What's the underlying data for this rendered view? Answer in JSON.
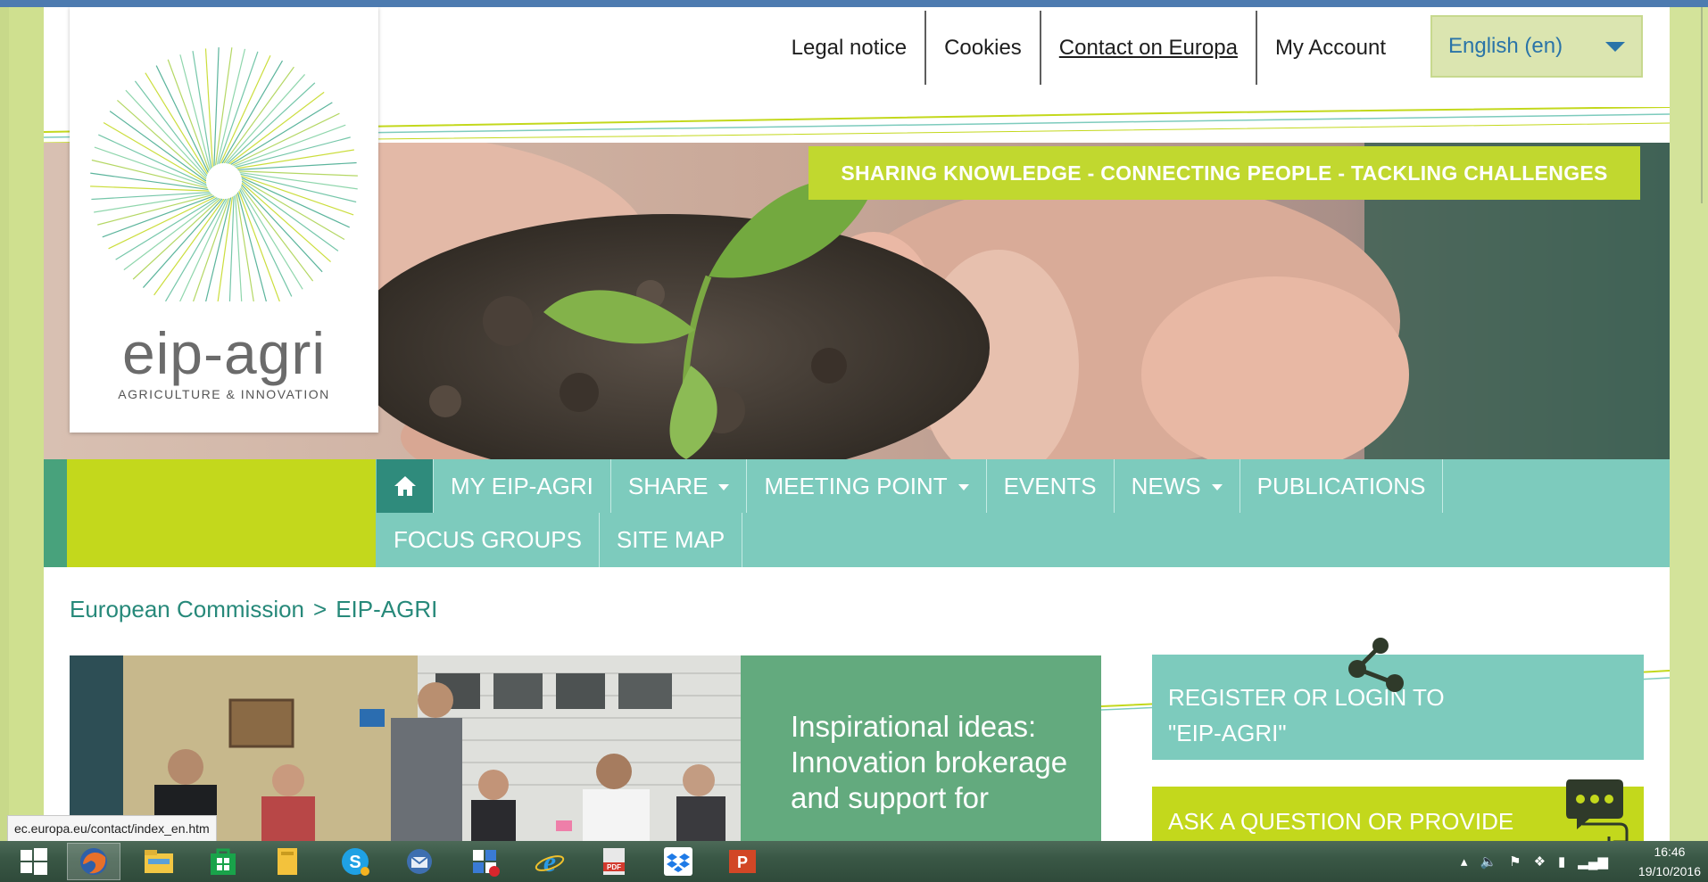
{
  "top_links": [
    "Legal notice",
    "Cookies",
    "Contact on Europa",
    "My Account"
  ],
  "language_selector": {
    "value": "English (en)"
  },
  "slogan": "SHARING KNOWLEDGE - CONNECTING PEOPLE - TACKLING CHALLENGES",
  "logo": {
    "name": "eip-agri",
    "tagline": "AGRICULTURE & INNOVATION"
  },
  "nav": {
    "row1": [
      {
        "label": "MY EIP-AGRI",
        "dropdown": false
      },
      {
        "label": "SHARE",
        "dropdown": true
      },
      {
        "label": "MEETING POINT",
        "dropdown": true
      },
      {
        "label": "EVENTS",
        "dropdown": false
      },
      {
        "label": "NEWS",
        "dropdown": true
      },
      {
        "label": "PUBLICATIONS",
        "dropdown": false
      }
    ],
    "row2": [
      {
        "label": "FOCUS GROUPS",
        "dropdown": false
      },
      {
        "label": "SITE MAP",
        "dropdown": false
      }
    ]
  },
  "breadcrumb": {
    "first": "European Commission",
    "separator": ">",
    "last": "EIP-AGRI"
  },
  "featured": {
    "title": "Inspirational ideas: Innovation brokerage and support for"
  },
  "cta": {
    "register": "REGISTER OR LOGIN TO \"EIP-AGRI\"",
    "ask": "ASK A QUESTION OR PROVIDE"
  },
  "status_url": "ec.europa.eu/contact/index_en.htm",
  "taskbar": {
    "icons": [
      "start-icon",
      "firefox-icon",
      "file-explorer-icon",
      "store-icon",
      "folder-icon",
      "skype-icon",
      "thunderbird-icon",
      "calendar-app-icon",
      "internet-explorer-icon",
      "pdf-icon",
      "dropbox-icon",
      "powerpoint-icon"
    ],
    "time": "16:46",
    "date": "19/10/2016"
  },
  "colors": {
    "teal_nav": "#7dcbbd",
    "lime": "#c3d81c",
    "dark_teal": "#2f8b7c",
    "green_panel": "#63aa7e",
    "breadcrumb": "#27897a"
  }
}
